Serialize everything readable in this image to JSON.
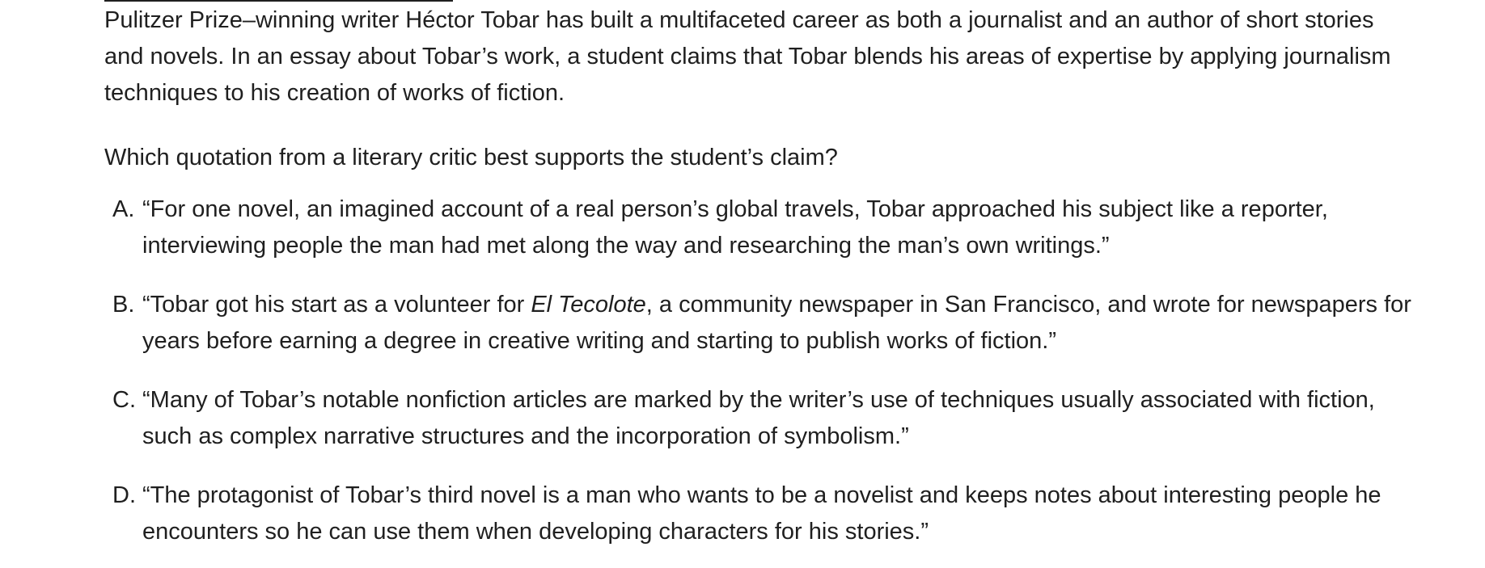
{
  "passage": "Pulitzer Prize–winning writer Héctor Tobar has built a multifaceted career as both a journalist and an author of short stories and novels. In an essay about Tobar’s work, a student claims that Tobar blends his areas of expertise by applying journalism techniques to his creation of works of fiction.",
  "question": "Which quotation from a literary critic best supports the student’s claim?",
  "options": [
    {
      "letter": "A.",
      "text": "“For one novel, an imagined account of a real person’s global travels, Tobar approached his subject like a reporter, interviewing people the man had met along the way and researching the man’s own writings.”"
    },
    {
      "letter": "B.",
      "text_before": "“Tobar got his start as a volunteer for ",
      "italic": "El Tecolote",
      "text_after": ", a community newspaper in San Francisco, and wrote for newspapers for years before earning a degree in creative writing and starting to publish works of fiction.”"
    },
    {
      "letter": "C.",
      "text": "“Many of Tobar’s notable nonfiction articles are marked by the writer’s use of techniques usually associated with fiction, such as complex narrative structures and the incorporation of symbolism.”"
    },
    {
      "letter": "D.",
      "text": "“The protagonist of Tobar’s third novel is a man who wants to be a novelist and keeps notes about interesting people he encounters so he can use them when developing characters for his stories.”"
    }
  ]
}
